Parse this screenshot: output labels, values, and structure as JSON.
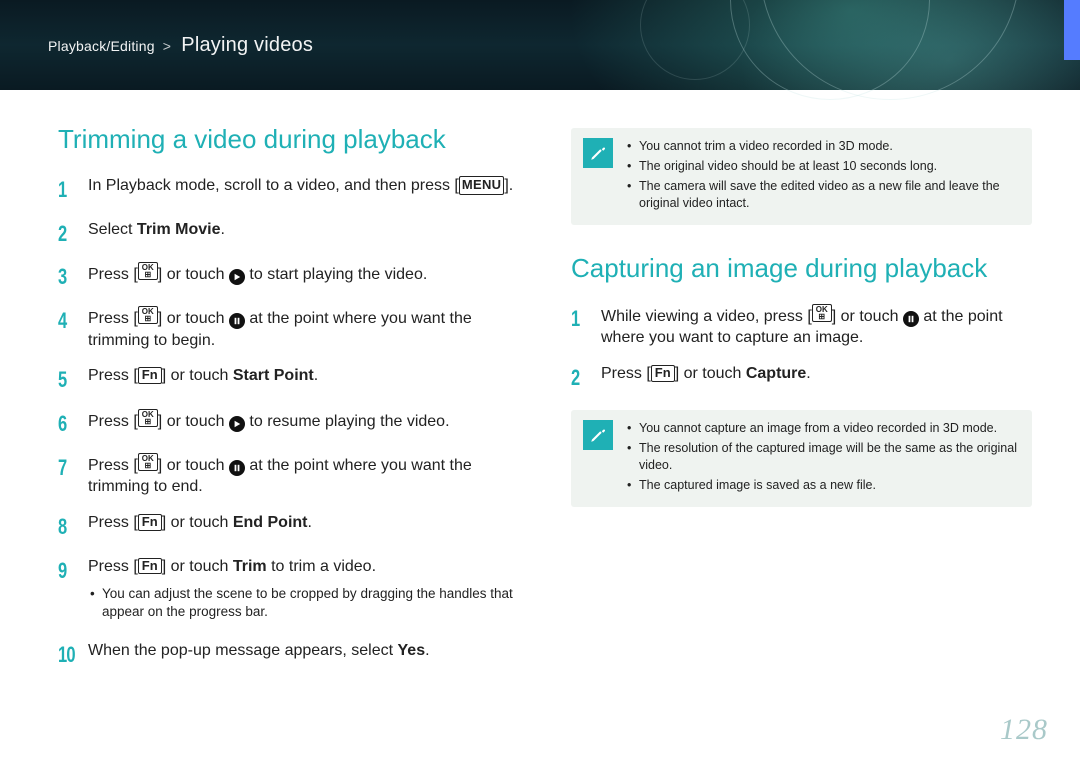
{
  "breadcrumb": {
    "parent": "Playback/Editing",
    "section": "Playing videos"
  },
  "page_number": "128",
  "left": {
    "heading": "Trimming a video during playback",
    "steps": [
      {
        "n": "1",
        "pre": "In Playback mode, scroll to a video, and then press [",
        "btn": "MENU",
        "post": "]."
      },
      {
        "n": "2",
        "html": "Select <b>Trim Movie</b>."
      },
      {
        "n": "3",
        "pre": "Press [",
        "btn": "OK",
        "mid": "] or touch ",
        "icon": "play",
        "post": " to start playing the video."
      },
      {
        "n": "4",
        "pre": "Press [",
        "btn": "OK",
        "mid": "] or touch ",
        "icon": "pause",
        "post": " at the point where you want the trimming to begin."
      },
      {
        "n": "5",
        "pre": "Press [",
        "btn": "Fn",
        "mid": "] or touch ",
        "bold": "Start Point",
        "post": "."
      },
      {
        "n": "6",
        "pre": "Press [",
        "btn": "OK",
        "mid": "] or touch ",
        "icon": "play",
        "post": " to resume playing the video."
      },
      {
        "n": "7",
        "pre": "Press [",
        "btn": "OK",
        "mid": "] or touch ",
        "icon": "pause",
        "post": " at the point where you want the trimming to end."
      },
      {
        "n": "8",
        "pre": "Press [",
        "btn": "Fn",
        "mid": "] or touch ",
        "bold": "End Point",
        "post": "."
      },
      {
        "n": "9",
        "pre": "Press [",
        "btn": "Fn",
        "mid": "] or touch ",
        "bold": "Trim",
        "post": " to trim a video.",
        "sub": [
          "You can adjust the scene to be cropped by dragging the handles that appear on the progress bar."
        ]
      },
      {
        "n": "10",
        "html": "When the pop-up message appears, select <b>Yes</b>."
      }
    ]
  },
  "right": {
    "note1": [
      "You cannot trim a video recorded in 3D mode.",
      "The original video should be at least 10 seconds long.",
      "The camera will save the edited video as a new file and leave the original video intact."
    ],
    "heading": "Capturing an image during playback",
    "steps": [
      {
        "n": "1",
        "pre": "While viewing a video, press [",
        "btn": "OK",
        "mid": "] or touch ",
        "icon": "pause",
        "post": " at the point where you want to capture an image."
      },
      {
        "n": "2",
        "pre": "Press [",
        "btn": "Fn",
        "mid": "] or touch ",
        "bold": "Capture",
        "post": "."
      }
    ],
    "note2": [
      "You cannot capture an image from a video recorded in 3D mode.",
      "The resolution of the captured image will be the same as the original video.",
      "The captured image is saved as a new file."
    ]
  }
}
